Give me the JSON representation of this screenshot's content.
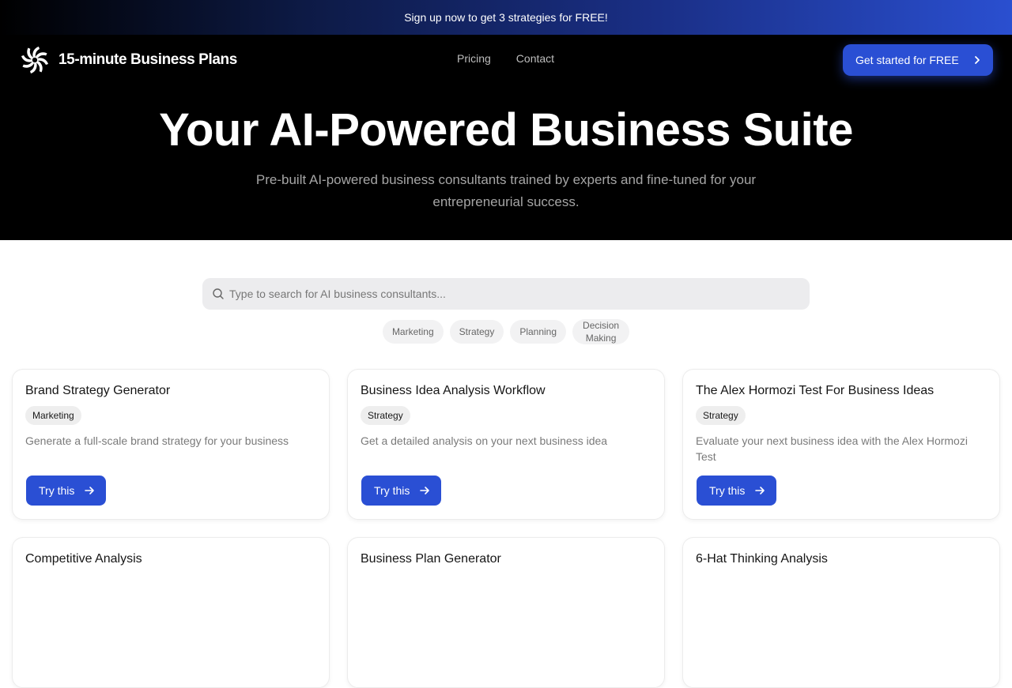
{
  "promo": {
    "text": "Sign up now to get 3 strategies for FREE!"
  },
  "header": {
    "brand": "15-minute Business Plans",
    "logo_icon": "swirl-logo-icon",
    "nav": [
      {
        "label": "Pricing"
      },
      {
        "label": "Contact"
      }
    ],
    "cta_label": "Get started for FREE",
    "cta_icon": "chevron-right-icon"
  },
  "hero": {
    "title": "Your AI-Powered Business Suite",
    "subtitle": "Pre-built AI-powered business consultants trained by experts and fine-tuned for your entrepreneurial success."
  },
  "search": {
    "placeholder": "Type to search for AI business consultants...",
    "value": "",
    "icon": "search-icon"
  },
  "filters": [
    {
      "label": "Marketing"
    },
    {
      "label": "Strategy"
    },
    {
      "label": "Planning"
    },
    {
      "label": "Decision Making"
    }
  ],
  "cards": [
    {
      "title": "Brand Strategy Generator",
      "tag": "Marketing",
      "description": "Generate a full-scale brand strategy for your business",
      "button": "Try this"
    },
    {
      "title": "Business Idea Analysis Workflow",
      "tag": "Strategy",
      "description": "Get a detailed analysis on your next business idea",
      "button": "Try this"
    },
    {
      "title": "The Alex Hormozi Test For Business Ideas",
      "tag": "Strategy",
      "description": "Evaluate your next business idea with the Alex Hormozi Test",
      "button": "Try this"
    },
    {
      "title": "Competitive Analysis",
      "tag": "",
      "description": "",
      "button": ""
    },
    {
      "title": "Business Plan Generator",
      "tag": "",
      "description": "",
      "button": ""
    },
    {
      "title": "6-Hat Thinking Analysis",
      "tag": "",
      "description": "",
      "button": ""
    }
  ],
  "colors": {
    "accent": "#2a4fd4",
    "hero_bg": "#000000",
    "chip_bg": "#f2f2f3",
    "search_bg": "#ececee"
  }
}
